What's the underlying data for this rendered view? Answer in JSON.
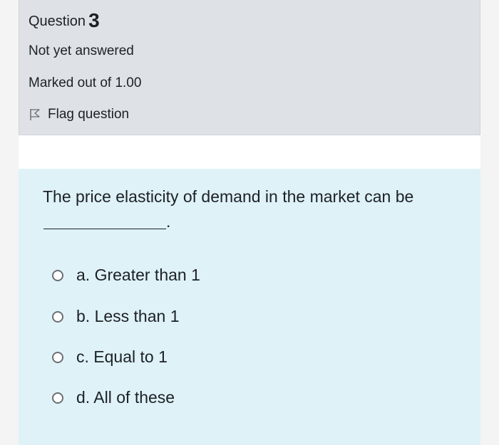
{
  "question_info": {
    "label": "Question",
    "number": "3",
    "state": "Not yet answered",
    "grade": "Marked out of 1.00",
    "flag_label": "Flag question"
  },
  "question": {
    "text": "The price elasticity of demand in the market can be",
    "blank_suffix": ".",
    "options": [
      {
        "label": "a. Greater than 1",
        "selected": false
      },
      {
        "label": "b. Less than 1",
        "selected": false
      },
      {
        "label": "c. Equal to 1",
        "selected": false
      },
      {
        "label": "d. All of these",
        "selected": false
      }
    ]
  },
  "colors": {
    "info_background": "#dee2e6",
    "content_background": "#def2f8",
    "text": "#1d2125"
  }
}
